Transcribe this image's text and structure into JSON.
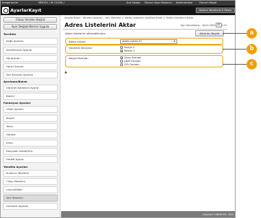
{
  "topbar": {
    "device": "Imagerunner",
    "model": "MF832C / IR C1533i /",
    "right_a": "Ana Gezgin",
    "right_b": "Oturum Açan Kullanıcı :",
    "right_c": "Administrator",
    "logout": "Oturum Kapat"
  },
  "header": {
    "app_title": "AyarlarKayıt",
    "system_mgr_button": "Sistem Yöneticisi E-Posta"
  },
  "sidebar": {
    "top_buttons": [
      "Cihazı Yeniden Başlat",
      "Ayar Değişikliklerini Uygula"
    ],
    "sections": [
      {
        "title": "Tercihler",
        "items": [
          "Kağıt Ayarları",
          "Sesli/Ekranlı Ayarlar",
          "Ağ Ayarları",
          "Harici Arayüz",
          "Ses Seviyesi Ayarları"
        ]
      },
      {
        "title": "Ayarlama/Bakım",
        "items": [
          "Görüntü Kalitesini Ayarla",
          "Bakım"
        ]
      },
      {
        "title": "Fonksiyon Ayarları",
        "items": [
          "Ortak Ayarlar",
          "Kopya",
          "Yazıcı",
          "Gönder",
          "Alma",
          "Dosyalan Saklaİ/Eriş",
          "Hedefi Ayarla"
        ]
      },
      {
        "title": "Yönetim Ayarları",
        "items": [
          "Kullanıcı Yönetimi",
          "Cihaz Yönetimi",
          "Lisans/Diğer",
          "Veri Yönetimi",
          "Güvenlik Ayarları"
        ]
      }
    ],
    "active_item": "Veri Yönetimi"
  },
  "main": {
    "breadcrumb": "Ayarlar/Kayıt : Yönetim Ayarları : Veri Yönetimi > Adres Listelerini İçe/Dışa Aktar > Adres Listelerini Aktar",
    "title": "Adres Listelerini Aktar",
    "last_updated": "Son Güncelleme : 10/12 2020 10:12:23",
    "refresh_icon": "refresh-icon",
    "instruction": "Adres listelerini aktarabilirsiniz.",
    "start_button": "Aktarımı Başlat",
    "fields": {
      "address_list_label": "Adres Listesi:",
      "address_list_value": "Adres Listesi 01",
      "security_label": "Güvenlik Seviyesi:",
      "security_options": [
        "Seviye 1",
        "Seviye 2"
      ],
      "security_selected": "Seviye 2",
      "format_label": "Dosya Formatı:",
      "format_options": [
        "Cihaz Formatı",
        "LDAP Formatı",
        "CSV Formatı"
      ],
      "format_selected": "Cihaz Formatı"
    },
    "back_to_top": "▲"
  },
  "footer": {
    "copyright": "Copyright CANON INC. 2020"
  },
  "callouts": [
    "a",
    "b",
    "c"
  ],
  "colors": {
    "callout": "#f29c00",
    "header": "#141414",
    "highlight_box": "#f0a000"
  }
}
